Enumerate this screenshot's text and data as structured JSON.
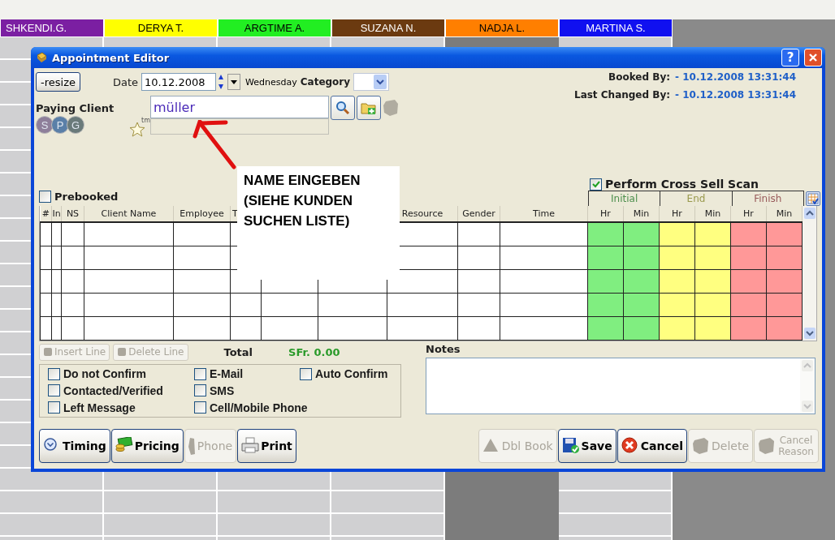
{
  "schedule": {
    "staff": [
      {
        "name": "SHKENDI.G.",
        "color": "#7b1fa2",
        "off": false
      },
      {
        "name": "DERYA T.",
        "color": "#ffff00",
        "off": false
      },
      {
        "name": "ARGTIME A.",
        "color": "#22ee22",
        "off": false
      },
      {
        "name": "SUZANA N.",
        "color": "#6b3a10",
        "off": false
      },
      {
        "name": "NADJA L.",
        "color": "#ff7f00",
        "off": true
      },
      {
        "name": "MARTINA S.",
        "color": "#1010f0",
        "off": false
      }
    ]
  },
  "dialog": {
    "title": "Appointment Editor",
    "help_button": "?",
    "resize_button": "-resize",
    "date": {
      "label": "Date",
      "value": "10.12.2008",
      "weekday": "Wednesday"
    },
    "category": {
      "label": "Category"
    },
    "booked_by": {
      "label": "Booked By:",
      "value": "- 10.12.2008 13:31:44"
    },
    "last_changed_by": {
      "label": "Last Changed By:",
      "value": "- 10.12.2008 13:31:44"
    },
    "paying_client": {
      "label": "Paying Client",
      "value": "müller"
    },
    "client_badges": [
      {
        "letter": "S",
        "color": "#8e7f9a"
      },
      {
        "letter": "P",
        "color": "#5a7fa8"
      },
      {
        "letter": "G",
        "color": "#6a7a7a"
      }
    ],
    "star_mark": "tm",
    "cross_sell_scan": {
      "label": "Perform Cross Sell Scan",
      "checked": true
    },
    "prebooked": {
      "label": "Prebooked",
      "checked": false
    },
    "time_groups": [
      {
        "label": "Initial",
        "color": "#80ee80"
      },
      {
        "label": "End",
        "color": "#ffff80"
      },
      {
        "label": "Finish",
        "color": "#ff9898"
      }
    ],
    "table": {
      "columns": [
        {
          "label": "#"
        },
        {
          "label": "In"
        },
        {
          "label": "NS"
        },
        {
          "label": "Client Name"
        },
        {
          "label": "Employee"
        },
        {
          "label": "T"
        },
        {},
        {},
        {
          "label": "Resource"
        },
        {
          "label": "Gender"
        },
        {
          "label": "Time"
        },
        {
          "label": "Hr"
        },
        {
          "label": "Min"
        },
        {
          "label": "Hr"
        },
        {
          "label": "Min"
        },
        {
          "label": "Hr"
        },
        {
          "label": "Min"
        }
      ]
    },
    "line_buttons": [
      {
        "label": "Insert Line",
        "disabled": true
      },
      {
        "label": "Delete Line",
        "disabled": true
      }
    ],
    "total": {
      "label": "Total",
      "value": "SFr. 0.00"
    },
    "notes": {
      "label": "Notes"
    },
    "contact_options": [
      {
        "label": "Do not Confirm",
        "checked": false
      },
      {
        "label": "Contacted/Verified",
        "checked": false
      },
      {
        "label": "Left Message",
        "checked": false
      },
      {
        "label": "E-Mail",
        "checked": false
      },
      {
        "label": "SMS",
        "checked": false
      },
      {
        "label": "Cell/Mobile Phone",
        "checked": false
      },
      {
        "label": "Auto Confirm",
        "checked": false
      }
    ],
    "left_buttons": [
      {
        "label": "Timing",
        "kind": "clock",
        "disabled": false
      },
      {
        "label": "Pricing",
        "kind": "money",
        "disabled": false
      },
      {
        "label": "Phone",
        "kind": "phone",
        "disabled": true
      },
      {
        "label": "Print",
        "kind": "printer",
        "disabled": false
      }
    ],
    "right_buttons": [
      {
        "label": "Dbl Book",
        "kind": "dbl",
        "disabled": true
      },
      {
        "label": "Save",
        "kind": "save",
        "disabled": false
      },
      {
        "label": "Cancel",
        "kind": "cancel",
        "disabled": false
      },
      {
        "label": "Delete",
        "kind": "blob",
        "disabled": true
      },
      {
        "label": "Cancel Reason",
        "kind": "blob",
        "disabled": true
      }
    ]
  },
  "annotation": {
    "text": "NAME EINGEBEN (SIEHE KUNDEN SUCHEN LISTE)"
  }
}
